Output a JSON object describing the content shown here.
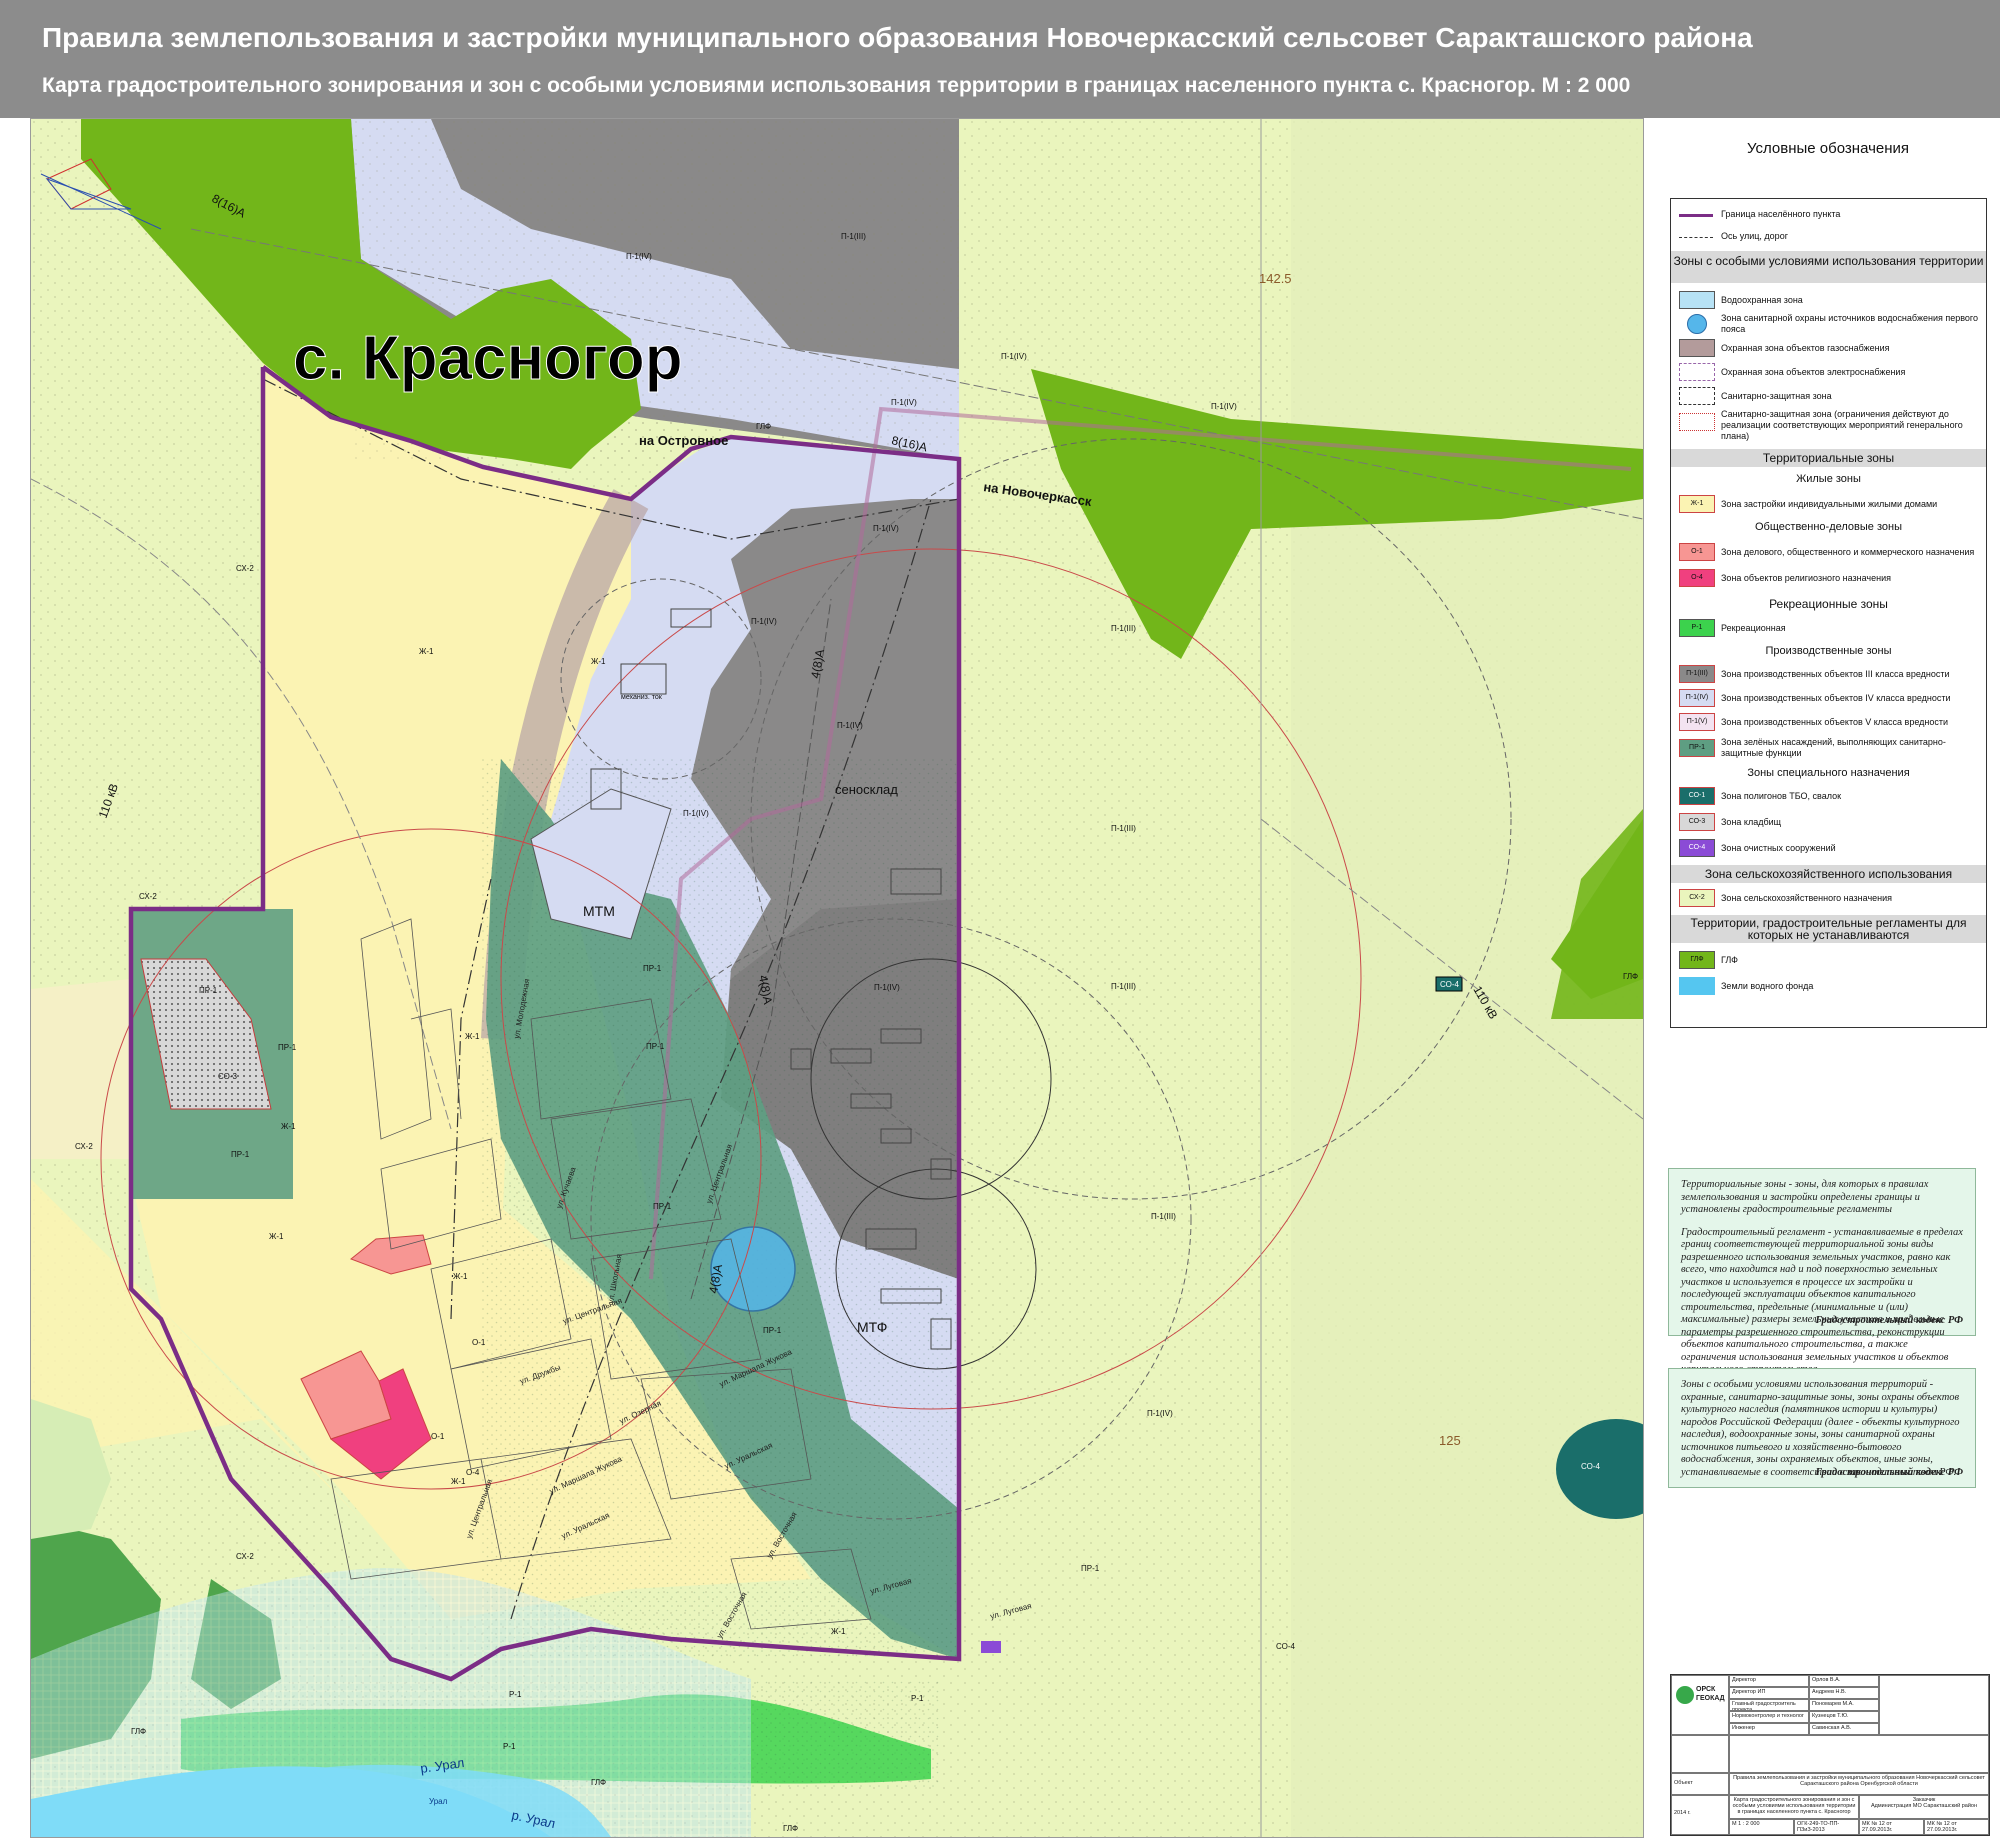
{
  "header": {
    "title": "Правила землепользования и застройки муниципального образования Новочеркасский сельсовет Саракташского района",
    "subtitle": "Карта градостроительного зонирования и зон с особыми условиями использования территории в границах населенного пункта с. Красногор. М : 2 000"
  },
  "map": {
    "place_name": "с. Красногор",
    "colors": {
      "zh1": "#fbf3b3",
      "sx2": "#eaf5bd",
      "glf": "#72b61a",
      "p1_iii": "#8a8989",
      "p1_iv": "#d5dbf2",
      "pr1": "#5e9e82",
      "o1": "#f79693",
      "o4": "#f0407f",
      "co3": "#c7c7c7",
      "co4": "#1a6e6a",
      "water": "#7fdcf8",
      "r1": "#3cd24d",
      "boundary": "#7b2d86"
    },
    "road_labels": {
      "to_ostrovnoe": "на Островное",
      "to_novocherkassk": "на Новочеркасск"
    },
    "objects": {
      "mtm": "МТМ",
      "mtf": "МТФ",
      "senosklad": "сеносклад",
      "mehtok": "механиз. ток"
    },
    "power_lines": {
      "l1": "8(16)А",
      "l2": "8(16)А",
      "l3": "110 кВ",
      "l4": "110 кВ",
      "l5": "4(8)А",
      "l6": "4(8)А",
      "l7": "4(8)А"
    },
    "elevations": [
      "142.5",
      "125"
    ],
    "river": {
      "r1": "р. Урал",
      "r2": "р. Урал",
      "r3": "Урал"
    },
    "zone_labels": {
      "zh1_a": "Ж-1",
      "zh1_b": "Ж-1",
      "zh1_c": "Ж-1",
      "zh1_d": "Ж-1",
      "zh1_e": "Ж-1",
      "zh1_f": "Ж-1",
      "zh1_g": "Ж-1",
      "zh1_h": "Ж-1",
      "sx2_a": "СХ-2",
      "sx2_b": "СХ-2",
      "sx2_c": "СХ-2",
      "sx2_d": "СХ-2",
      "glf_a": "ГЛФ",
      "glf_b": "ГЛФ",
      "glf_c": "ГЛФ",
      "glf_d": "ГЛФ",
      "glf_e": "ГЛФ",
      "p3_a": "П-1(III)",
      "p3_b": "П-1(III)",
      "p3_c": "П-1(III)",
      "p3_d": "П-1(III)",
      "p3_e": "П-1(III)",
      "p4_a": "П-1(IV)",
      "p4_b": "П-1(IV)",
      "p4_c": "П-1(IV)",
      "p4_d": "П-1(IV)",
      "p4_e": "П-1(IV)",
      "p4_f": "П-1(IV)",
      "p4_g": "П-1(IV)",
      "p4_h": "П-1(IV)",
      "p4_i": "П-1(IV)",
      "p4_j": "П-1(IV)",
      "pr1_a": "ПР-1",
      "pr1_b": "ПР-1",
      "pr1_c": "ПР-1",
      "pr1_d": "ПР-1",
      "pr1_e": "ПР-1",
      "pr1_f": "ПР-1",
      "pr1_g": "ПР-1",
      "pr1_h": "ПР-1",
      "o1_a": "О-1",
      "o1_b": "О-1",
      "o4": "О-4",
      "co3": "СО-3",
      "co4_a": "СО-4",
      "co4_b": "СО-4",
      "co4_c": "СО-4",
      "r1_a": "Р-1",
      "r1_b": "Р-1",
      "r1_c": "Р-1"
    },
    "streets": {
      "s1": "ул. Центральная",
      "s2": "ул. Центральная",
      "s3": "ул. Центральная",
      "s4": "ул. Дружбы",
      "s5": "ул. Озерная",
      "s6": "ул. Кучаева",
      "s7": "ул. Маршала Жукова",
      "s8": "ул. Маршала Жукова",
      "s9": "ул. Уральская",
      "s10": "ул. Уральская",
      "s11": "ул. Восточная",
      "s12": "ул. Восточная",
      "s13": "ул. Луговая",
      "s14": "ул. Луговая",
      "s15": "ул. Молодежная",
      "s16": "ул. Школьная"
    }
  },
  "legend": {
    "title": "Условные обозначения",
    "items": {
      "boundary": "Граница населённого пункта",
      "axis": "Ось улиц, дорог",
      "special_header": "Зоны с особыми условиями использования территории",
      "water_protect": "Водоохранная зона",
      "sanitary_water": "Зона санитарной охраны источников водоснабжения первого пояса",
      "gas_zone": "Охранная зона объектов газоснабжения",
      "power_zone": "Охранная зона объектов электроснабжения",
      "sanitary_zone": "Санитарно-защитная зона",
      "sanitary_zone2": "Санитарно-защитная зона (ограничения действуют до реализации соответствующих мероприятий генерального плана)",
      "territorial_header": "Территориальные зоны",
      "residential_header": "Жилые зоны",
      "zh1_code": "Ж-1",
      "zh1": "Зона застройки индивидуальными жилыми домами",
      "public_header": "Общественно-деловые зоны",
      "o1_code": "О-1",
      "o1": "Зона делового, общественного и коммерческого назначения",
      "o4_code": "О-4",
      "o4": "Зона объектов религиозного назначения",
      "recreation_header": "Рекреационные зоны",
      "r1_code": "Р-1",
      "r1": "Рекреационная",
      "production_header": "Производственные зоны",
      "p3_code": "П-1(III)",
      "p3": "Зона производственных объектов III класса вредности",
      "p4_code": "П-1(IV)",
      "p4": "Зона производственных объектов IV класса вредности",
      "p5_code": "П-1(V)",
      "p5": "Зона производственных объектов V класса вредности",
      "pr1_code": "ПР-1",
      "pr1": "Зона зелёных насаждений, выполняющих санитарно-защитные функции",
      "special_purpose_header": "Зоны специального назначения",
      "co1_code": "СО-1",
      "co1": "Зона полигонов ТБО, свалок",
      "co3_code": "СО-3",
      "co3": "Зона кладбищ",
      "co4_code": "СО-4",
      "co4": "Зона очистных сооружений",
      "agri_header": "Зона сельскохозяйственного использования",
      "sx2_code": "СХ-2",
      "sx2": "Зона сельскохозяйственного назначения",
      "noreg_header": "Территории, градостроительные регламенты для которых не устанавливаются",
      "glf_code": "ГЛФ",
      "glf": "ГЛФ",
      "waterfund": "Земли водного фонда"
    }
  },
  "notes": {
    "note1_p1": "Территориальные зоны - зоны, для которых в правилах землепользования и застройки определены границы и установлены градостроительные регламенты",
    "note1_p2": "Градостроительный регламент - устанавливаемые в пределах границ соответствующей территориальной зоны виды разрешенного использования земельных участков, равно как всего, что находится над и под поверхностью земельных участков и используется в процессе их застройки и последующей эксплуатации объектов капитального строительства, предельные (минимальные и (или) максимальные) размеры земельных участков и предельные параметры разрешенного строительства, реконструкции объектов капитального строительства, а также ограничения использования земельных участков и объектов капитального строительства",
    "note1_src": "Градостроительный кодекс РФ",
    "note2_p1": "Зоны с особыми условиями использования территорий - охранные, санитарно-защитные зоны, зоны охраны объектов культурного наследия (памятников истории и культуры) народов Российской Федерации (далее - объекты культурного наследия), водоохранные зоны, зоны санитарной охраны источников питьевого и хозяйственно-бытового водоснабжения, зоны охраняемых объектов, иные зоны, устанавливаемые в соответствии с законодательством РФ.",
    "note2_src": "Градостроительный кодекс РФ"
  },
  "stamp": {
    "logo_line1": "ОРСК",
    "logo_line2": "ГЕОКАД",
    "roles": [
      "Директор",
      "Директор ИП",
      "Главный градостроитель проекта",
      "Нормоконтролер и технолог",
      "Инженер"
    ],
    "names": [
      "Орлов В.А.",
      "Андреев Н.В.",
      "Пономарев М.А.",
      "Кузнецов Т.Ю.",
      "Савинская А.В."
    ],
    "object_label": "Объект",
    "project": "Правила землепользования и застройки муниципального образования Новочеркасский сельсовет Саракташского района Оренбургской области",
    "sheet_title": "Карта градостроительного зонирования и зон с особыми условиями использования территории в границах населенного пункта с. Красногор",
    "year": "2014 г.",
    "scale": "М 1 : 2 000",
    "code": "ОГК-249-ТО-ПП-ПЗиЗ-2013",
    "customer_label": "Заказчик",
    "customer": "Администрация МО Саракташский район",
    "contract": "МК № 12 от 27.09.2013г.",
    "contract2": "МК № 12 от 27.09.2013г."
  }
}
